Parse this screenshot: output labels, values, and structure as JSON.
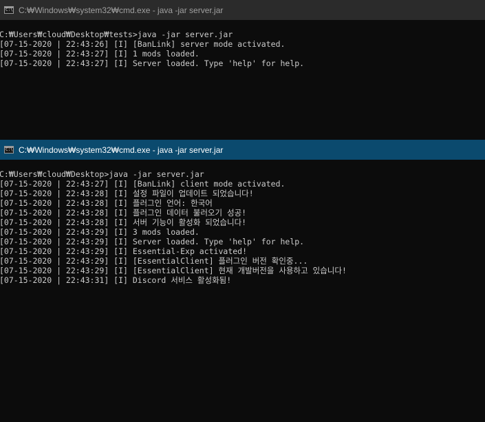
{
  "windows": [
    {
      "title": "C:₩Windows₩system32₩cmd.exe - java  -jar server.jar",
      "active": false,
      "lines": [
        "C:₩Users₩cloud₩Desktop₩tests>java -jar server.jar",
        "[07-15-2020 | 22:43:26] [I] [BanLink] server mode activated.",
        "[07-15-2020 | 22:43:27] [I] 1 mods loaded.",
        "[07-15-2020 | 22:43:27] [I] Server loaded. Type 'help' for help."
      ]
    },
    {
      "title": "C:₩Windows₩system32₩cmd.exe - java  -jar server.jar",
      "active": true,
      "lines": [
        "C:₩Users₩cloud₩Desktop>java -jar server.jar",
        "[07-15-2020 | 22:43:27] [I] [BanLink] client mode activated.",
        "[07-15-2020 | 22:43:28] [I] 설정 파일이 업데이트 되었습니다!",
        "[07-15-2020 | 22:43:28] [I] 플러그인 언어: 한국어",
        "[07-15-2020 | 22:43:28] [I] 플러그인 데이터 불러오기 성공!",
        "[07-15-2020 | 22:43:28] [I] 서버 기능이 활성화 되었습니다!",
        "[07-15-2020 | 22:43:29] [I] 3 mods loaded.",
        "[07-15-2020 | 22:43:29] [I] Server loaded. Type 'help' for help.",
        "[07-15-2020 | 22:43:29] [I] Essential-Exp activated!",
        "[07-15-2020 | 22:43:29] [I] [EssentialClient] 플러그인 버전 확인중...",
        "[07-15-2020 | 22:43:29] [I] [EssentialClient] 현재 개발버전을 사용하고 있습니다!",
        "[07-15-2020 | 22:43:31] [I] Discord 서비스 활성화됨!"
      ]
    }
  ],
  "icons": {
    "terminal": "cmd-icon",
    "glyph": "C:\\"
  },
  "colors": {
    "titlebar_active": "#0b4a6e",
    "titlebar_inactive": "#2b2b2b",
    "console_bg": "#0c0c0c",
    "console_text": "#cccccc"
  }
}
